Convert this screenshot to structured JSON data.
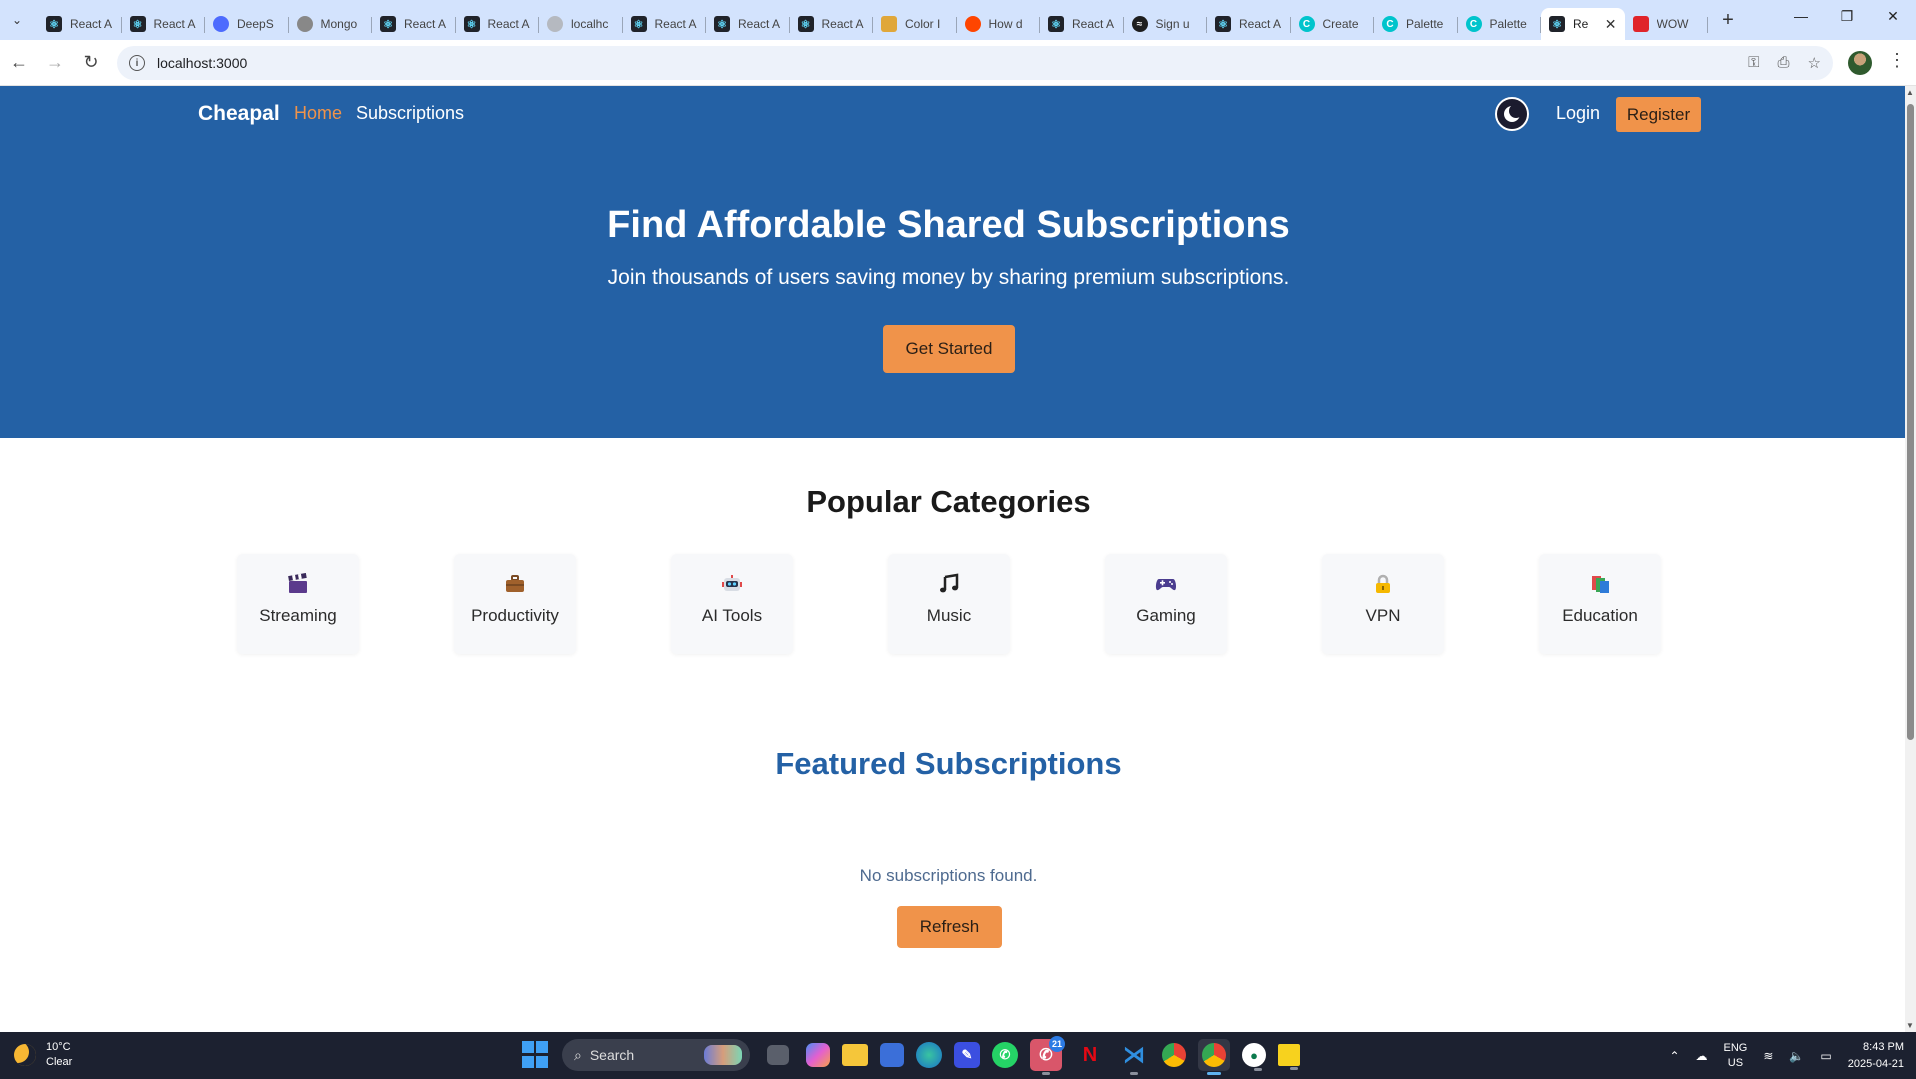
{
  "browser": {
    "tabs": [
      {
        "title": "React A",
        "icon": "react-icon"
      },
      {
        "title": "React A",
        "icon": "react-icon"
      },
      {
        "title": "DeepS",
        "icon": "deepseek-icon"
      },
      {
        "title": "Mongo",
        "icon": "mongodb-icon"
      },
      {
        "title": "React A",
        "icon": "react-icon"
      },
      {
        "title": "React A",
        "icon": "react-icon"
      },
      {
        "title": "localhc",
        "icon": "globe-icon"
      },
      {
        "title": "React A",
        "icon": "react-icon"
      },
      {
        "title": "React A",
        "icon": "react-icon"
      },
      {
        "title": "React A",
        "icon": "react-icon"
      },
      {
        "title": "Color I",
        "icon": "color-icon"
      },
      {
        "title": "How d",
        "icon": "reddit-icon"
      },
      {
        "title": "React A",
        "icon": "react-icon"
      },
      {
        "title": "Sign u",
        "icon": "spotify-icon"
      },
      {
        "title": "React A",
        "icon": "react-icon"
      },
      {
        "title": "Create",
        "icon": "canva-icon"
      },
      {
        "title": "Palette",
        "icon": "canva-icon"
      },
      {
        "title": "Palette",
        "icon": "canva-icon"
      },
      {
        "title": "Re",
        "icon": "react-icon",
        "active": true
      },
      {
        "title": "WOW",
        "icon": "wow-icon"
      }
    ],
    "url": "localhost:3000"
  },
  "site": {
    "brand": "Cheapal",
    "nav": {
      "home": "Home",
      "subscriptions": "Subscriptions",
      "login": "Login",
      "register": "Register"
    },
    "hero": {
      "title": "Find Affordable Shared Subscriptions",
      "subtitle": "Join thousands of users saving money by sharing premium subscriptions.",
      "cta": "Get Started"
    },
    "categories_title": "Popular Categories",
    "categories": [
      {
        "label": "Streaming",
        "icon": "clapperboard-icon"
      },
      {
        "label": "Productivity",
        "icon": "briefcase-icon"
      },
      {
        "label": "AI Tools",
        "icon": "robot-icon"
      },
      {
        "label": "Music",
        "icon": "music-note-icon"
      },
      {
        "label": "Gaming",
        "icon": "gamepad-icon"
      },
      {
        "label": "VPN",
        "icon": "lock-icon"
      },
      {
        "label": "Education",
        "icon": "books-icon"
      }
    ],
    "featured_title": "Featured Subscriptions",
    "empty_message": "No subscriptions found.",
    "refresh": "Refresh"
  },
  "taskbar": {
    "temperature": "10°C",
    "weather": "Clear",
    "search_placeholder": "Search",
    "whatsapp_badge": "21",
    "lang": "ENG",
    "region": "US",
    "time": "8:43 PM",
    "date": "2025-04-21"
  },
  "colors": {
    "hero": "#2461a5",
    "accent": "#f0934a"
  }
}
